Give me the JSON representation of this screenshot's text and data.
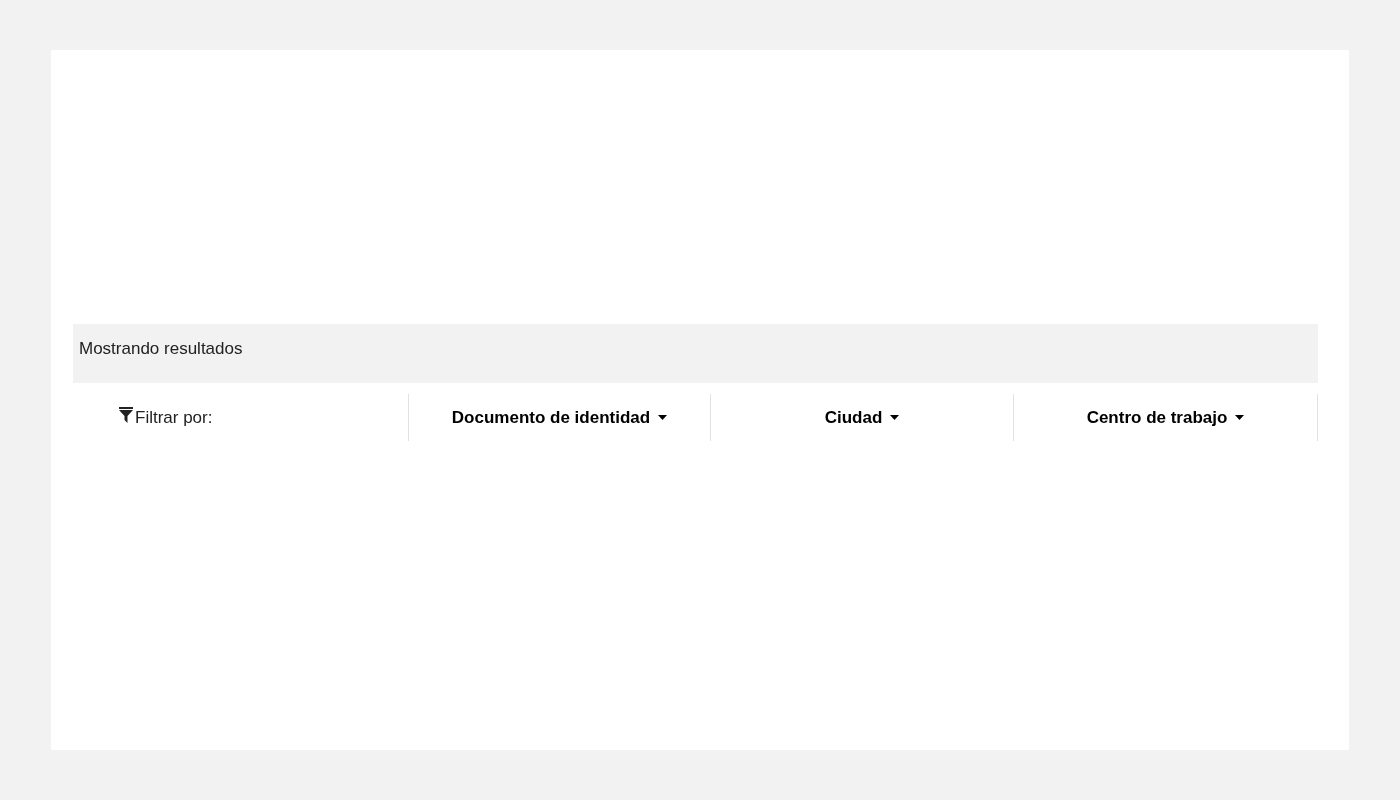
{
  "results_banner": {
    "text": "Mostrando resultados"
  },
  "filter_bar": {
    "label": "Filtrar por:",
    "filters": [
      {
        "label": "Documento de identidad"
      },
      {
        "label": "Ciudad"
      },
      {
        "label": "Centro de trabajo"
      }
    ]
  }
}
